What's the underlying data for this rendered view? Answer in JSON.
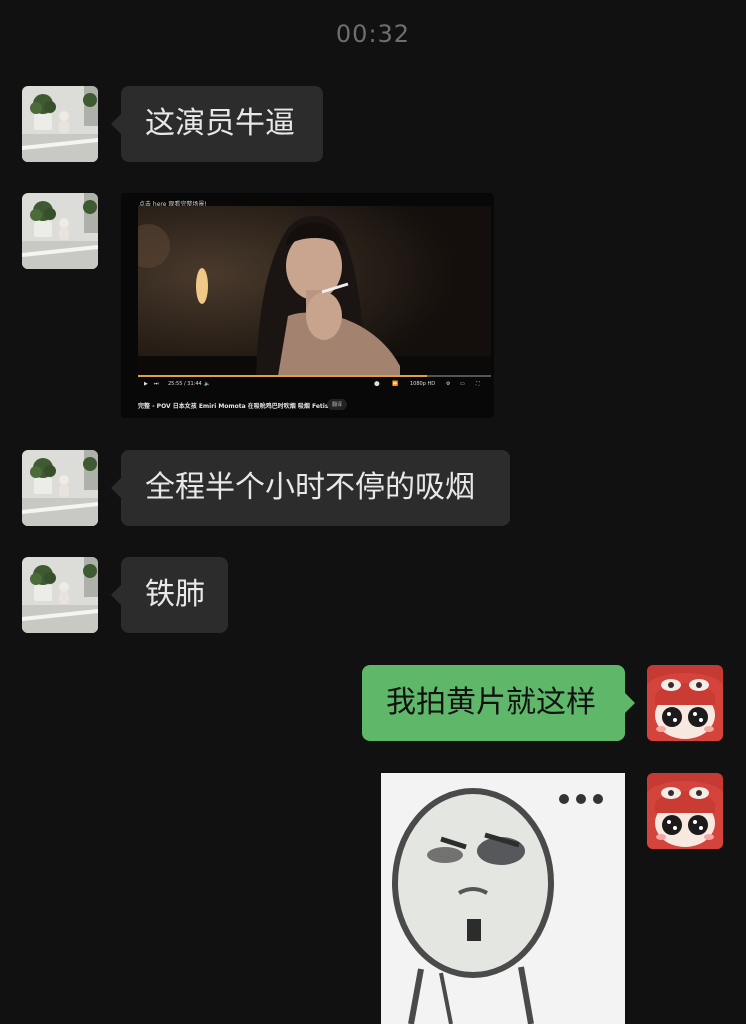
{
  "chat": {
    "timestamp": "00:32",
    "messages": [
      {
        "sender": "other",
        "type": "text",
        "text": "这演员牛逼"
      },
      {
        "sender": "other",
        "type": "video_screenshot",
        "notice": "点击 here 观看完整场景!",
        "time_display": "25:55 / 31:44",
        "quality": "1080p HD",
        "progress": 0.82,
        "title": "完整 - POV 日本女孩 Emiri Momota 在吸吮鸡巴时吹烟 吸烟 Fetish",
        "translate_label": "翻译"
      },
      {
        "sender": "other",
        "type": "text",
        "text": "全程半个小时不停的吸烟"
      },
      {
        "sender": "other",
        "type": "text",
        "text": "铁肺"
      },
      {
        "sender": "me",
        "type": "text",
        "text": "我拍黄片就这样"
      },
      {
        "sender": "me",
        "type": "sticker",
        "sticker": "squinting-meme-face"
      }
    ]
  },
  "colors": {
    "background": "#111111",
    "incoming_bubble": "#2c2c2c",
    "outgoing_bubble": "#5fb86a"
  }
}
